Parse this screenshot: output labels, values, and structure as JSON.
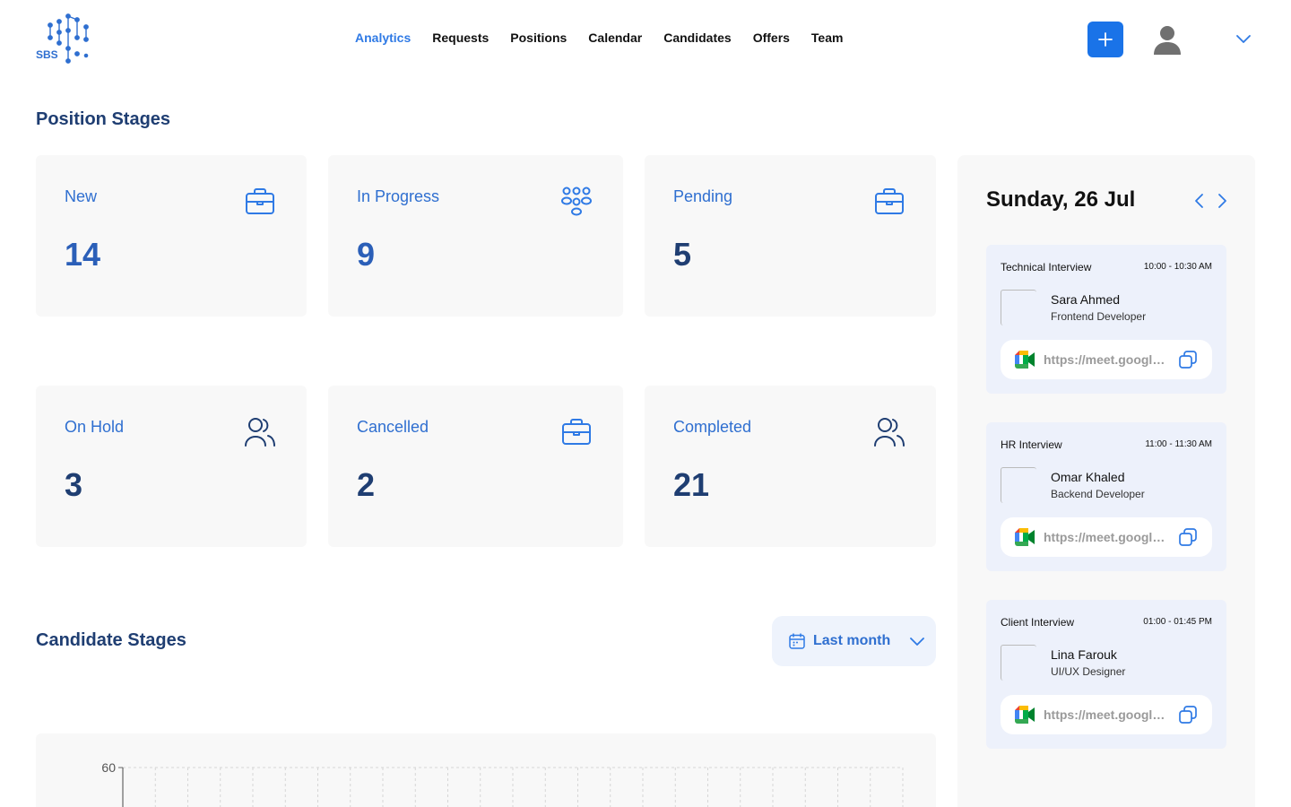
{
  "header": {
    "logo_text": "SBS",
    "nav": [
      {
        "label": "Analytics",
        "active": true
      },
      {
        "label": "Requests",
        "active": false
      },
      {
        "label": "Positions",
        "active": false
      },
      {
        "label": "Calendar",
        "active": false
      },
      {
        "label": "Candidates",
        "active": false
      },
      {
        "label": "Offers",
        "active": false
      },
      {
        "label": "Team",
        "active": false
      }
    ],
    "add_icon": "plus-icon",
    "avatar_icon": "user-avatar-icon",
    "menu_icon": "chevron-down-icon"
  },
  "position_stages": {
    "title": "Position Stages",
    "cards": [
      {
        "label": "New",
        "value": "14",
        "icon": "briefcase-icon"
      },
      {
        "label": "In Progress",
        "value": "9",
        "icon": "group-icon"
      },
      {
        "label": "Pending",
        "value": "5",
        "icon": "briefcase-icon"
      },
      {
        "label": "On Hold",
        "value": "3",
        "icon": "users-icon"
      },
      {
        "label": "Cancelled",
        "value": "2",
        "icon": "briefcase-icon"
      },
      {
        "label": "Completed",
        "value": "21",
        "icon": "users-icon"
      }
    ]
  },
  "candidate_stages": {
    "title": "Candidate Stages",
    "filter": {
      "label": "Last month",
      "icon": "calendar-icon"
    }
  },
  "chart_data": {
    "type": "bar",
    "y_ticks": [
      "60"
    ],
    "grid": true
  },
  "calendar": {
    "date": "Sunday, 26 Jul",
    "events": [
      {
        "title": "Technical Interview",
        "time": "10:00 - 10:30 AM",
        "name": "Sara Ahmed",
        "role": "Frontend Developer",
        "link": "https://meet.google.com/"
      },
      {
        "title": "HR Interview",
        "time": "11:00 - 11:30 AM",
        "name": "Omar Khaled",
        "role": "Backend Developer",
        "link": "https://meet.google.com/"
      },
      {
        "title": "Client Interview",
        "time": "01:00 - 01:45 PM",
        "name": "Lina Farouk",
        "role": "UI/UX Designer",
        "link": "https://meet.google.com/"
      }
    ]
  },
  "colors": {
    "accent": "#1a73e8",
    "heading": "#1f3e72",
    "card_bg": "#f8f8f8",
    "event_bg": "#edf1fb"
  }
}
